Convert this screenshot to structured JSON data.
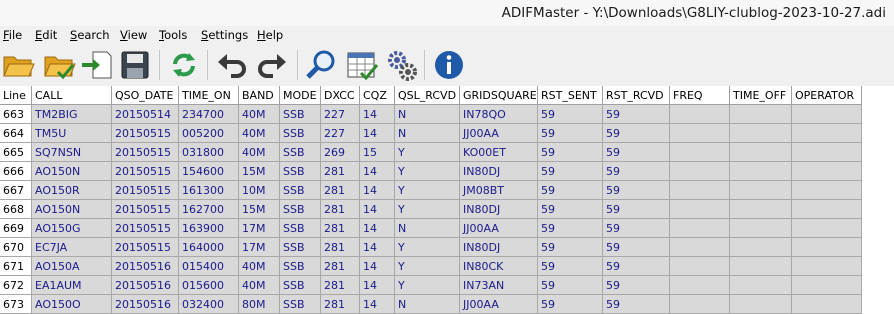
{
  "window": {
    "title": "ADIFMaster - Y:\\Downloads\\G8LIY-clublog-2023-10-27.adi"
  },
  "menu": [
    {
      "key": "F",
      "rest": "ile"
    },
    {
      "key": "E",
      "rest": "dit"
    },
    {
      "key": "S",
      "rest": "earch"
    },
    {
      "key": "V",
      "rest": "iew"
    },
    {
      "key": "T",
      "rest": "ools"
    },
    {
      "key": "S",
      "rest": "ettings"
    },
    {
      "key": "H",
      "rest": "elp"
    }
  ],
  "toolbar": [
    {
      "name": "open-folder-icon"
    },
    {
      "name": "open-verified-icon"
    },
    {
      "name": "import-icon"
    },
    {
      "name": "save-disk-icon"
    },
    {
      "name": "refresh-icon"
    },
    {
      "name": "undo-icon"
    },
    {
      "name": "redo-icon"
    },
    {
      "name": "search-icon"
    },
    {
      "name": "validate-table-icon"
    },
    {
      "name": "settings-gears-icon"
    },
    {
      "name": "info-icon"
    }
  ],
  "colors": {
    "cell_bg": "#d9d9d9",
    "cell_text": "#1a1a8c",
    "header_bg": "#ffffff"
  },
  "table": {
    "columns": [
      "Line",
      "CALL",
      "QSO_DATE",
      "TIME_ON",
      "BAND",
      "MODE",
      "DXCC",
      "CQZ",
      "QSL_RCVD",
      "GRIDSQUARE",
      "RST_SENT",
      "RST_RCVD",
      "FREQ",
      "TIME_OFF",
      "OPERATOR"
    ],
    "rows": [
      [
        "663",
        "TM2BIG",
        "20150514",
        "234700",
        "40M",
        "SSB",
        "227",
        "14",
        "N",
        "IN78QO",
        "59",
        "59",
        "",
        "",
        ""
      ],
      [
        "664",
        "TM5U",
        "20150515",
        "005200",
        "40M",
        "SSB",
        "227",
        "14",
        "N",
        "JJ00AA",
        "59",
        "59",
        "",
        "",
        ""
      ],
      [
        "665",
        "SQ7NSN",
        "20150515",
        "031800",
        "40M",
        "SSB",
        "269",
        "15",
        "Y",
        "KO00ET",
        "59",
        "59",
        "",
        "",
        ""
      ],
      [
        "666",
        "AO150N",
        "20150515",
        "154600",
        "15M",
        "SSB",
        "281",
        "14",
        "Y",
        "IN80DJ",
        "59",
        "59",
        "",
        "",
        ""
      ],
      [
        "667",
        "AO150R",
        "20150515",
        "161300",
        "10M",
        "SSB",
        "281",
        "14",
        "Y",
        "JM08BT",
        "59",
        "59",
        "",
        "",
        ""
      ],
      [
        "668",
        "AO150N",
        "20150515",
        "162700",
        "15M",
        "SSB",
        "281",
        "14",
        "Y",
        "IN80DJ",
        "59",
        "59",
        "",
        "",
        ""
      ],
      [
        "669",
        "AO150G",
        "20150515",
        "163900",
        "17M",
        "SSB",
        "281",
        "14",
        "N",
        "JJ00AA",
        "59",
        "59",
        "",
        "",
        ""
      ],
      [
        "670",
        "EC7JA",
        "20150515",
        "164000",
        "17M",
        "SSB",
        "281",
        "14",
        "Y",
        "IN80DJ",
        "59",
        "59",
        "",
        "",
        ""
      ],
      [
        "671",
        "AO150A",
        "20150516",
        "015400",
        "40M",
        "SSB",
        "281",
        "14",
        "Y",
        "IN80CK",
        "59",
        "59",
        "",
        "",
        ""
      ],
      [
        "672",
        "EA1AUM",
        "20150516",
        "015600",
        "40M",
        "SSB",
        "281",
        "14",
        "Y",
        "IN73AN",
        "59",
        "59",
        "",
        "",
        ""
      ],
      [
        "673",
        "AO150O",
        "20150516",
        "032400",
        "80M",
        "SSB",
        "281",
        "14",
        "N",
        "JJ00AA",
        "59",
        "59",
        "",
        "",
        ""
      ]
    ]
  }
}
